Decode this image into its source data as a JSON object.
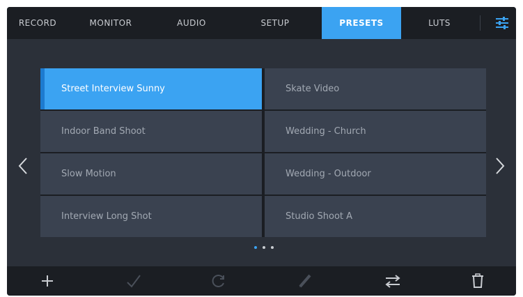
{
  "tabs": [
    {
      "label": "RECORD",
      "active": false
    },
    {
      "label": "MONITOR",
      "active": false
    },
    {
      "label": "AUDIO",
      "active": false
    },
    {
      "label": "SETUP",
      "active": false
    },
    {
      "label": "PRESETS",
      "active": true
    },
    {
      "label": "LUTS",
      "active": false
    }
  ],
  "menu_icon": "sliders-icon",
  "presets": [
    {
      "label": "Street Interview Sunny",
      "selected": true
    },
    {
      "label": "Skate Video",
      "selected": false
    },
    {
      "label": "Indoor Band Shoot",
      "selected": false
    },
    {
      "label": "Wedding  - Church",
      "selected": false
    },
    {
      "label": "Slow Motion",
      "selected": false
    },
    {
      "label": "Wedding - Outdoor",
      "selected": false
    },
    {
      "label": "Interview Long Shot",
      "selected": false
    },
    {
      "label": "Studio Shoot A",
      "selected": false
    }
  ],
  "pagination": {
    "pages": 3,
    "current": 1
  },
  "toolbar": [
    {
      "icon": "plus-icon",
      "enabled": true
    },
    {
      "icon": "checkmark-icon",
      "enabled": false
    },
    {
      "icon": "refresh-icon",
      "enabled": false
    },
    {
      "icon": "pencil-icon",
      "enabled": false
    },
    {
      "icon": "swap-arrows-icon",
      "enabled": true
    },
    {
      "icon": "trash-icon",
      "enabled": true
    }
  ],
  "colors": {
    "accent": "#3ba3f2",
    "background": "#2b3039",
    "bar": "#1b1e23",
    "cell": "#3a4250"
  }
}
